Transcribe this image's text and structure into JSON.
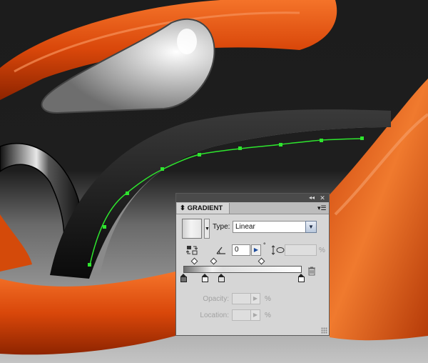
{
  "panel": {
    "title": "GRADIENT",
    "type_label": "Type:",
    "type_value": "Linear",
    "angle_value": "0",
    "degree_symbol": "°",
    "aspect_unit": "%",
    "opacity_label": "Opacity:",
    "opacity_unit": "%",
    "location_label": "Location:",
    "location_unit": "%",
    "collapse_glyph": "◂◂",
    "close_glyph": "✕",
    "menu_glyph": "▾☰",
    "angle_step_glyph": "▶",
    "select_arrow_glyph": "▼",
    "swatch_arrow_glyph": "▼",
    "step_glyph": "▶",
    "gradient_stops": [
      {
        "color": "#6d6d6d"
      },
      {
        "color": "#f2f2f2"
      },
      {
        "color": "#e0e0e0"
      },
      {
        "color": "#ffffff"
      }
    ],
    "icons": {
      "reverse": "reverse-gradient-icon",
      "angle": "angle-icon",
      "aspect": "aspect-ratio-icon",
      "delete_stop": "trash-icon"
    }
  },
  "colors": {
    "canvas_dark": "#1c1c1c",
    "canvas_light": "#bdbdbd",
    "orange": "#e0520d",
    "path_green": "#2ee52e",
    "panel_bg": "#d6d6d6"
  }
}
